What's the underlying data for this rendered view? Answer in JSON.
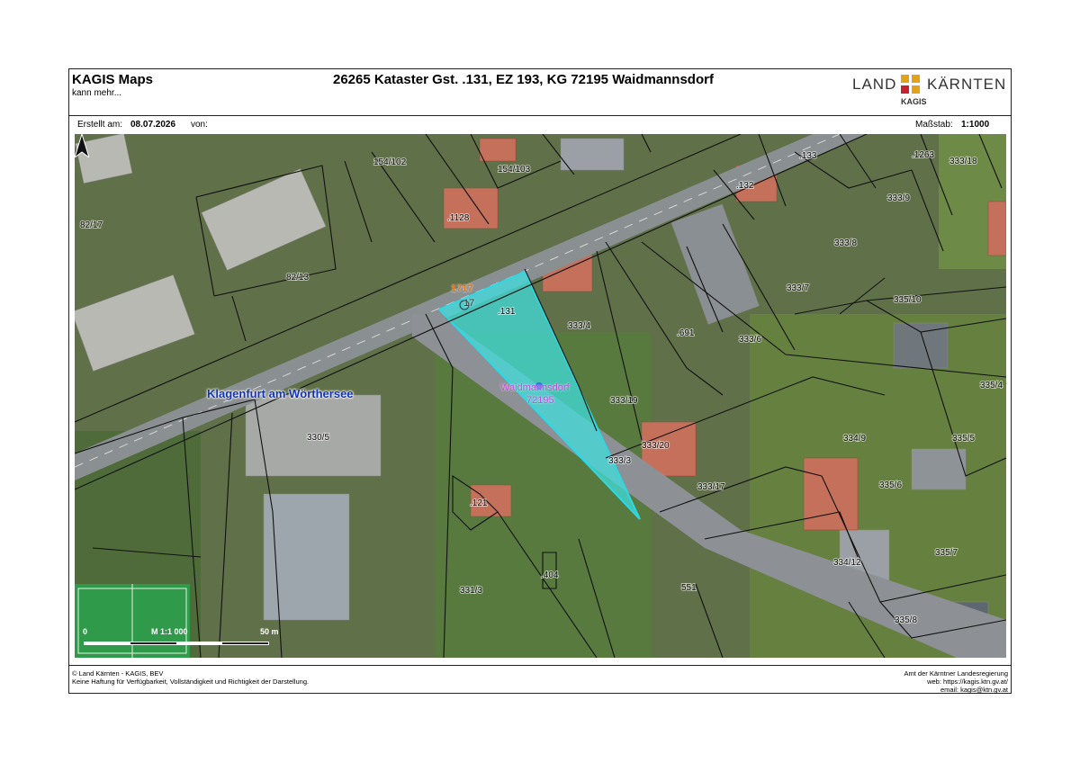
{
  "header": {
    "app_title": "KAGIS Maps",
    "app_subtitle": "kann mehr...",
    "document_title": "26265 Kataster Gst. .131, EZ 193, KG 72195 Waidmannsdorf",
    "logo": {
      "left": "LAND",
      "right": "KÄRNTEN",
      "sub": "KAGIS",
      "colors": [
        "#e3a21a",
        "#c8202f"
      ]
    }
  },
  "meta": {
    "created_label": "Erstellt am:",
    "created_value": "08.07.2026",
    "by_label": "von:",
    "by_value": "",
    "scale_label": "Maßstab:",
    "scale_value": "1:1000"
  },
  "map": {
    "town_label": "Klagenfurt am Wörthersee",
    "kg_name": "Waidmannsdorf",
    "kg_number": "72195",
    "marker_a": "1717",
    "marker_b": "17",
    "highlight_color": "#3fe0e0",
    "parcel_labels": [
      "154/102",
      "154/103",
      ".1128",
      "82/17",
      "82/13",
      ".133",
      ".132",
      ".1263",
      "333/18",
      "333/9",
      "333/8",
      "333/7",
      "335/10",
      ".131",
      "333/4",
      ".691",
      "333/6",
      "335/4",
      "333/19",
      "333/20",
      "333/3",
      "333/17",
      "334/9",
      "335/5",
      "335/6",
      "330/5",
      ".121",
      ".404",
      "331/3",
      "551",
      "335/7",
      "334/12",
      "335/8",
      "17"
    ],
    "scale_bar": {
      "zero": "0",
      "ratio": "M 1:1 000",
      "end": "50 m"
    }
  },
  "footer": {
    "left_line1": "© Land Kärnten - KAGIS, BEV",
    "left_line2": "Keine Haftung für Verfügbarkeit, Vollständigkeit und Richtigkeit der Darstellung.",
    "right_line1": "Amt der Kärntner Landesregierung",
    "right_line2": "web: https://kagis.ktn.gv.at/",
    "right_line3": "email: kagis@ktn.gv.at"
  }
}
